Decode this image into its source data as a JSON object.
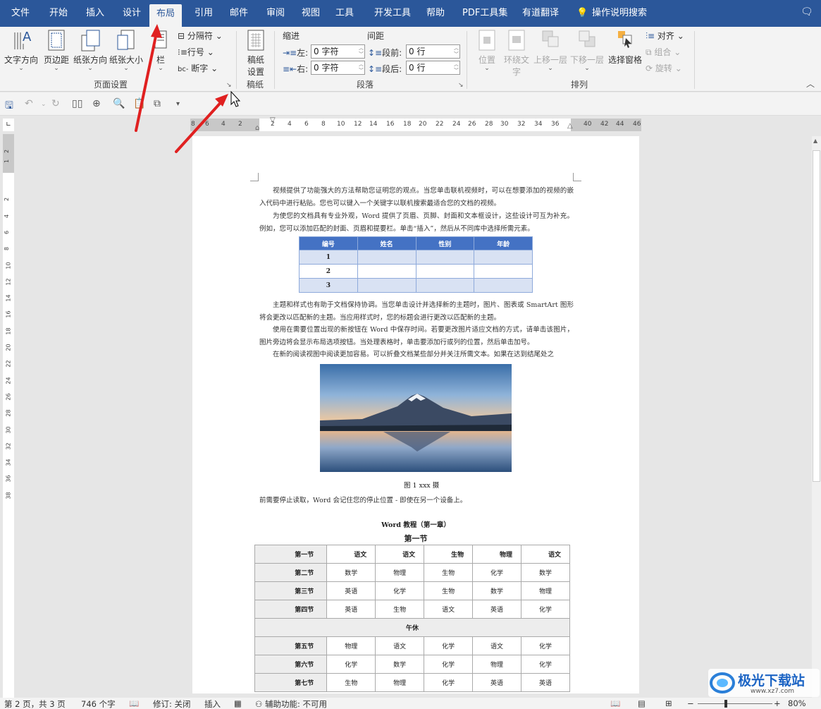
{
  "tabs": [
    "文件",
    "开始",
    "插入",
    "设计",
    "布局",
    "引用",
    "邮件",
    "审阅",
    "视图",
    "工具",
    "开发工具",
    "帮助",
    "PDF工具集",
    "有道翻译",
    "操作说明搜索"
  ],
  "ribbon": {
    "page_setup": {
      "text_dir": "文字方向",
      "margins": "页边距",
      "orientation": "纸张方向",
      "size": "纸张大小",
      "columns": "栏",
      "breaks": "分隔符",
      "line_numbers": "行号",
      "hyphen": "断字",
      "group": "页面设置"
    },
    "draft": {
      "btn1": "稿纸",
      "btn2": "设置",
      "group": "稿纸"
    },
    "paragraph": {
      "indent": "缩进",
      "spacing": "间距",
      "left": "左:",
      "right": "右:",
      "before": "段前:",
      "after": "段后:",
      "left_val": "0 字符",
      "right_val": "0 字符",
      "before_val": "0 行",
      "after_val": "0 行",
      "group": "段落"
    },
    "arrange": {
      "position": "位置",
      "wrap1": "环绕文",
      "wrap2": "字",
      "fwd": "上移一层",
      "back": "下移一层",
      "pane": "选择窗格",
      "align": "对齐",
      "group_btn": "组合",
      "rotate": "旋转",
      "group": "排列"
    }
  },
  "ruler": {
    "h": [
      "8",
      "6",
      "4",
      "2",
      "2",
      "4",
      "6",
      "8",
      "10",
      "12",
      "14",
      "16",
      "18",
      "20",
      "22",
      "24",
      "26",
      "28",
      "30",
      "32",
      "34",
      "36",
      "40",
      "42",
      "44",
      "46"
    ],
    "v": [
      "2",
      "1",
      "2",
      "4",
      "6",
      "8",
      "10",
      "12",
      "14",
      "16",
      "18",
      "20",
      "22",
      "24",
      "26",
      "28",
      "30",
      "32",
      "34",
      "36",
      "38"
    ]
  },
  "doc": {
    "p1": "视频提供了功能强大的方法帮助您证明您的观点。当您单击联机视频时，可以在想要添加的视频的嵌入代码中进行粘贴。您也可以键入一个关键字以联机搜索最适合您的文档的视频。",
    "p2": "为使您的文档具有专业外观，Word 提供了页眉、页脚、封面和文本框设计，这些设计可互为补充。例如，您可以添加匹配的封面、页眉和提要栏。单击“插入”，然后从不同库中选择所需元素。",
    "t1_head": [
      "编号",
      "姓名",
      "性别",
      "年龄"
    ],
    "t1_rows": [
      "1",
      "2",
      "3"
    ],
    "p3": "主题和样式也有助于文档保持协调。当您单击设计并选择新的主题时，图片、图表或 SmartArt 图形将会更改以匹配新的主题。当应用样式时，您的标题会进行更改以匹配新的主题。",
    "p4": "使用在需要位置出现的新按钮在 Word 中保存时间。若要更改图片适应文档的方式，请单击该图片，图片旁边将会显示布局选项按钮。当处理表格时，单击要添加行或列的位置，然后单击加号。",
    "p5": "在新的阅读视图中阅读更加容易。可以折叠文档某些部分并关注所需文本。如果在达到结尾处之",
    "caption": "图 1 xxx 摄",
    "p6": "前需要停止读取，Word 会记住您的停止位置 - 即使在另一个设备上。",
    "title1": "Word 教程（第一章）",
    "title2": "第一节",
    "t2": [
      [
        "第一节",
        "语文",
        "语文",
        "生物",
        "物理",
        "语文"
      ],
      [
        "第二节",
        "数学",
        "物理",
        "生物",
        "化学",
        "数学"
      ],
      [
        "第三节",
        "英语",
        "化学",
        "生物",
        "数学",
        "物理"
      ],
      [
        "第四节",
        "英语",
        "生物",
        "语文",
        "英语",
        "化学"
      ]
    ],
    "t2_break": "午休",
    "t2b": [
      [
        "第五节",
        "物理",
        "语文",
        "化学",
        "语文",
        "化学"
      ],
      [
        "第六节",
        "化学",
        "数学",
        "化学",
        "物理",
        "化学"
      ],
      [
        "第七节",
        "生物",
        "物理",
        "化学",
        "英语",
        "英语"
      ]
    ]
  },
  "status": {
    "page": "第 2 页，共 3 页",
    "words": "746 个字",
    "track": "修订: 关闭",
    "insert": "插入",
    "access": "辅助功能: 不可用",
    "zoom": "80%"
  },
  "watermark": "极光下载站",
  "watermark_url": "www.xz7.com"
}
